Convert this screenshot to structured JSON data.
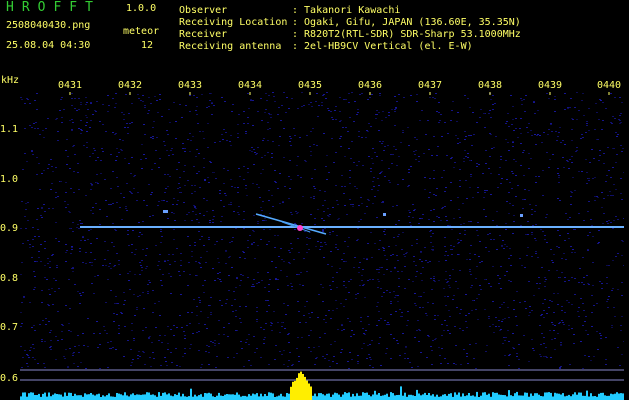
{
  "header": {
    "logo": "HROFFT",
    "version": "1.0.0",
    "filename": "2508040430.png",
    "meteor_label": "meteor",
    "datetime": "25.08.04 04:30",
    "meteor_count": "12"
  },
  "info": [
    {
      "label": "Observer",
      "value": ": Takanori Kawachi"
    },
    {
      "label": "Receiving Location",
      "value": ": Ogaki, Gifu, JAPAN (136.60E, 35.35N)"
    },
    {
      "label": "Receiver",
      "value": ": R820T2(RTL-SDR) SDR-Sharp 53.1000MHz"
    },
    {
      "label": "Receiving antenna",
      "value": ": 2el-HB9CV Vertical (el. E-W)"
    }
  ],
  "axis": {
    "y_unit": "kHz",
    "y_ticks": [
      "1.1",
      "1.0",
      "0.9",
      "0.8",
      "0.7",
      "0.6"
    ],
    "x_ticks": [
      "0431",
      "0432",
      "0433",
      "0434",
      "0435",
      "0436",
      "0437",
      "0438",
      "0439",
      "0440"
    ]
  },
  "colors": {
    "background": "#000000",
    "noise": "#12127a",
    "signal": "#6ab0ff",
    "meteor": "#ff44cc",
    "spectrum": "#22ccff",
    "peak": "#ffee00",
    "text": "#ffff66",
    "logo": "#33cc33"
  }
}
